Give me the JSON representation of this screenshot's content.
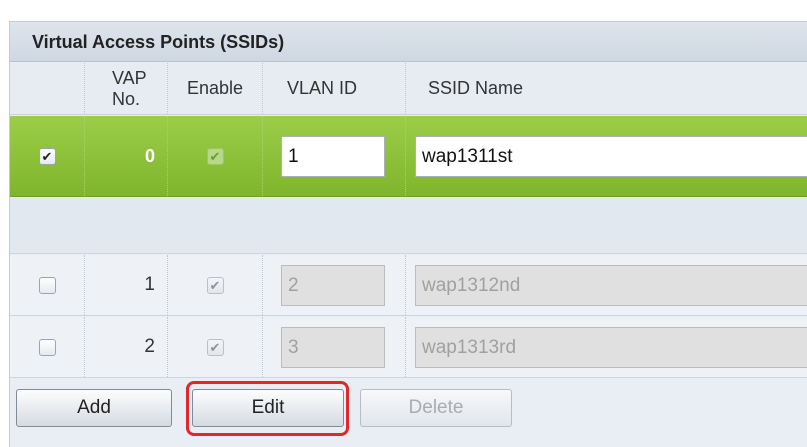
{
  "panel": {
    "title": "Virtual Access Points (SSIDs)"
  },
  "table": {
    "columns": {
      "vap_no": "VAP\nNo.",
      "vap_no_line1": "VAP",
      "vap_no_line2": "No.",
      "enable": "Enable",
      "vlan_id": "VLAN ID",
      "ssid_name": "SSID Name"
    },
    "rows": [
      {
        "selected": true,
        "vap_no": "0",
        "enabled": true,
        "vlan_id": "1",
        "ssid_name": "wap1311st",
        "editable": true
      },
      {
        "selected": false,
        "vap_no": "1",
        "enabled": true,
        "vlan_id": "2",
        "ssid_name": "wap1312nd",
        "editable": false
      },
      {
        "selected": false,
        "vap_no": "2",
        "enabled": true,
        "vlan_id": "3",
        "ssid_name": "wap1313rd",
        "editable": false
      }
    ]
  },
  "buttons": {
    "add": "Add",
    "edit": "Edit",
    "delete": "Delete"
  },
  "colors": {
    "selected_row": "#8fc23b",
    "highlight": "#e2262c",
    "panel_background": "#e9eef4"
  }
}
